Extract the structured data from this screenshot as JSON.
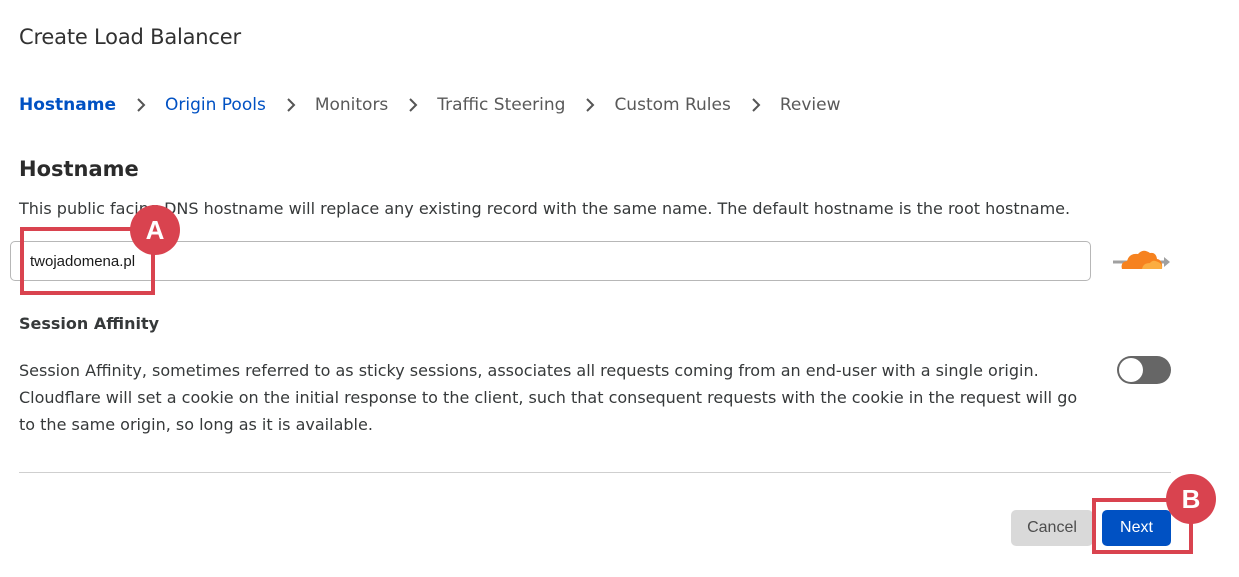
{
  "page": {
    "title": "Create Load Balancer"
  },
  "steps": [
    {
      "label": "Hostname"
    },
    {
      "label": "Origin Pools"
    },
    {
      "label": "Monitors"
    },
    {
      "label": "Traffic Steering"
    },
    {
      "label": "Custom Rules"
    },
    {
      "label": "Review"
    }
  ],
  "hostname": {
    "title": "Hostname",
    "description": "This public facing DNS hostname will replace any existing record with the same name. The default hostname is the root hostname.",
    "value": "twojadomena.pl",
    "proxy_icon": "cloudflare-proxy-icon"
  },
  "session_affinity": {
    "label": "Session Affinity",
    "description": "Session Affinity, sometimes referred to as sticky sessions, associates all requests coming from an end-user with a single origin. Cloudflare will set a cookie on the initial response to the client, such that consequent requests with the cookie in the request will go to the same origin, so long as it is available.",
    "enabled": false
  },
  "actions": {
    "cancel_label": "Cancel",
    "next_label": "Next"
  },
  "annotations": {
    "marker_a": "A",
    "marker_b": "B"
  },
  "colors": {
    "accent": "#0051c3",
    "highlight": "#d9434f",
    "cloud_orange": "#f6821f"
  }
}
